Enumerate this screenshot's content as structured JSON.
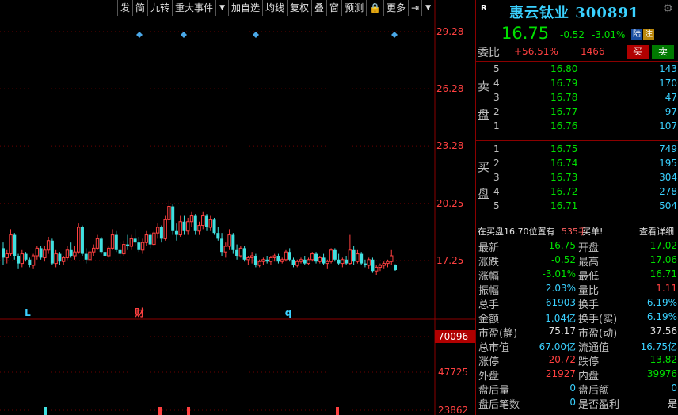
{
  "toolbar": {
    "items": [
      "发",
      "简",
      "九转",
      "重大事件",
      "▼",
      "加自选",
      "均线",
      "复权",
      "叠",
      "窗",
      "预测",
      "🔒",
      "更多",
      "⇥",
      "▼"
    ]
  },
  "chart_data": {
    "type": "candlestick",
    "y_ticks": [
      "29.28",
      "26.28",
      "23.28",
      "20.25",
      "17.25"
    ],
    "volume_ticks": [
      "70096",
      "47725",
      "23862"
    ],
    "markers": [
      "L",
      "财",
      "q"
    ],
    "candles": [
      [
        17.9,
        18.2,
        17.0,
        17.4
      ],
      [
        17.4,
        17.8,
        17.1,
        17.6
      ],
      [
        17.6,
        18.9,
        17.5,
        18.6
      ],
      [
        18.6,
        18.7,
        17.3,
        17.5
      ],
      [
        17.5,
        17.6,
        16.8,
        17.1
      ],
      [
        17.1,
        17.8,
        16.9,
        17.6
      ],
      [
        17.6,
        17.7,
        17.2,
        17.3
      ],
      [
        17.3,
        17.4,
        16.9,
        17.0
      ],
      [
        17.0,
        17.6,
        16.8,
        17.5
      ],
      [
        17.5,
        18.0,
        17.3,
        17.9
      ],
      [
        17.9,
        18.0,
        17.3,
        17.4
      ],
      [
        17.4,
        18.0,
        17.2,
        17.8
      ],
      [
        17.8,
        18.5,
        17.6,
        18.3
      ],
      [
        18.3,
        18.4,
        17.0,
        17.1
      ],
      [
        17.1,
        17.8,
        16.9,
        17.6
      ],
      [
        17.6,
        17.7,
        17.0,
        17.2
      ],
      [
        17.2,
        17.5,
        17.0,
        17.4
      ],
      [
        17.4,
        18.0,
        17.3,
        17.8
      ],
      [
        17.8,
        18.2,
        17.4,
        17.5
      ],
      [
        17.5,
        18.0,
        17.3,
        17.7
      ],
      [
        17.7,
        19.2,
        17.6,
        19.0
      ],
      [
        19.0,
        19.1,
        17.5,
        17.6
      ],
      [
        17.6,
        17.9,
        17.1,
        17.3
      ],
      [
        17.3,
        17.8,
        17.2,
        17.7
      ],
      [
        17.7,
        18.1,
        17.5,
        17.9
      ],
      [
        17.9,
        18.6,
        17.8,
        18.4
      ],
      [
        18.4,
        18.5,
        17.6,
        17.7
      ],
      [
        17.7,
        18.0,
        17.3,
        17.5
      ],
      [
        17.5,
        18.0,
        17.4,
        17.9
      ],
      [
        17.9,
        18.9,
        17.8,
        18.6
      ],
      [
        18.6,
        18.8,
        17.7,
        17.8
      ],
      [
        17.8,
        18.2,
        17.4,
        17.6
      ],
      [
        17.6,
        18.3,
        17.5,
        18.1
      ],
      [
        18.1,
        18.6,
        17.8,
        18.0
      ],
      [
        18.0,
        18.6,
        17.8,
        18.4
      ],
      [
        18.4,
        18.9,
        18.0,
        18.2
      ],
      [
        18.2,
        18.5,
        17.7,
        17.8
      ],
      [
        17.8,
        18.4,
        17.6,
        18.2
      ],
      [
        18.2,
        18.8,
        18.0,
        18.6
      ],
      [
        18.6,
        18.7,
        17.9,
        18.1
      ],
      [
        18.1,
        18.8,
        18.0,
        18.7
      ],
      [
        18.7,
        19.2,
        18.4,
        19.0
      ],
      [
        19.0,
        19.1,
        18.2,
        18.4
      ],
      [
        18.4,
        19.6,
        18.3,
        19.4
      ],
      [
        19.4,
        20.4,
        19.2,
        20.1
      ],
      [
        20.1,
        20.2,
        18.6,
        18.8
      ],
      [
        18.8,
        19.2,
        18.3,
        18.6
      ],
      [
        18.6,
        19.6,
        18.5,
        19.3
      ],
      [
        19.3,
        19.6,
        18.6,
        18.8
      ],
      [
        18.8,
        19.5,
        18.6,
        19.3
      ],
      [
        19.3,
        19.8,
        19.0,
        19.6
      ],
      [
        19.6,
        19.7,
        18.6,
        18.8
      ],
      [
        18.8,
        19.3,
        18.6,
        19.1
      ],
      [
        19.1,
        19.8,
        18.9,
        19.6
      ],
      [
        19.6,
        19.7,
        18.8,
        19.0
      ],
      [
        19.0,
        19.6,
        18.8,
        19.4
      ],
      [
        19.4,
        19.5,
        18.6,
        18.7
      ],
      [
        18.7,
        19.0,
        18.3,
        18.4
      ],
      [
        18.4,
        18.7,
        17.5,
        17.7
      ],
      [
        17.7,
        18.2,
        17.4,
        18.0
      ],
      [
        18.0,
        18.9,
        17.8,
        18.6
      ],
      [
        18.6,
        18.7,
        17.6,
        17.8
      ],
      [
        17.8,
        18.1,
        17.3,
        17.5
      ],
      [
        17.5,
        18.0,
        17.4,
        17.9
      ],
      [
        17.9,
        18.0,
        17.2,
        17.3
      ],
      [
        17.3,
        17.5,
        17.0,
        17.4
      ],
      [
        17.4,
        17.7,
        17.1,
        17.5
      ],
      [
        17.5,
        17.6,
        16.9,
        17.0
      ],
      [
        17.0,
        17.3,
        16.9,
        17.2
      ],
      [
        17.2,
        17.4,
        17.0,
        17.3
      ],
      [
        17.3,
        17.5,
        17.1,
        17.2
      ],
      [
        17.2,
        17.5,
        17.0,
        17.4
      ],
      [
        17.4,
        17.6,
        17.2,
        17.5
      ],
      [
        17.5,
        17.6,
        17.1,
        17.2
      ],
      [
        17.2,
        17.4,
        17.1,
        17.3
      ],
      [
        17.3,
        17.8,
        17.2,
        17.7
      ],
      [
        17.7,
        17.9,
        17.2,
        17.3
      ],
      [
        17.3,
        17.4,
        16.9,
        17.0
      ],
      [
        17.0,
        17.3,
        16.9,
        17.2
      ],
      [
        17.2,
        17.4,
        17.1,
        17.3
      ],
      [
        17.3,
        17.5,
        17.0,
        17.1
      ],
      [
        17.1,
        17.4,
        17.0,
        17.3
      ],
      [
        17.3,
        17.7,
        17.2,
        17.6
      ],
      [
        17.6,
        17.7,
        17.1,
        17.2
      ],
      [
        17.2,
        17.5,
        17.1,
        17.4
      ],
      [
        17.4,
        17.6,
        17.0,
        17.1
      ],
      [
        17.1,
        17.3,
        16.8,
        17.2
      ],
      [
        17.2,
        17.9,
        17.1,
        17.8
      ],
      [
        17.8,
        17.9,
        17.2,
        17.3
      ],
      [
        17.3,
        17.6,
        17.0,
        17.1
      ],
      [
        17.1,
        17.4,
        16.9,
        17.3
      ],
      [
        17.3,
        17.5,
        17.0,
        17.1
      ],
      [
        17.1,
        18.6,
        17.0,
        17.8
      ],
      [
        17.8,
        18.0,
        17.0,
        17.2
      ],
      [
        17.2,
        17.8,
        17.1,
        17.6
      ],
      [
        17.6,
        17.7,
        17.0,
        17.1
      ],
      [
        17.1,
        17.3,
        16.9,
        17.0
      ],
      [
        17.0,
        17.4,
        16.8,
        17.3
      ],
      [
        17.3,
        17.4,
        16.6,
        16.7
      ],
      [
        16.7,
        17.0,
        16.5,
        16.9
      ],
      [
        16.9,
        17.1,
        16.7,
        17.0
      ],
      [
        17.0,
        17.2,
        16.8,
        17.1
      ],
      [
        17.1,
        17.3,
        16.9,
        17.2
      ],
      [
        17.2,
        17.8,
        17.0,
        17.5
      ],
      [
        17.02,
        17.06,
        16.71,
        16.75
      ]
    ]
  },
  "header": {
    "r_badge": "R",
    "title": "惠云钛业 300891",
    "price": "16.75",
    "change": "-0.52",
    "change_pct": "-3.01%",
    "tag_lu": "陆",
    "tag_zhu": "注"
  },
  "weibi": {
    "label": "委比",
    "value": "+56.51%",
    "diff": "1466",
    "buy_label": "买",
    "sell_label": "卖"
  },
  "orderbook": {
    "sell_label_1": "卖",
    "sell_label_2": "盘",
    "buy_label_1": "买",
    "buy_label_2": "盘",
    "sell": [
      {
        "level": "5",
        "price": "16.80",
        "vol": "143"
      },
      {
        "level": "4",
        "price": "16.79",
        "vol": "170"
      },
      {
        "level": "3",
        "price": "16.78",
        "vol": "47"
      },
      {
        "level": "2",
        "price": "16.77",
        "vol": "97"
      },
      {
        "level": "1",
        "price": "16.76",
        "vol": "107"
      }
    ],
    "buy": [
      {
        "level": "1",
        "price": "16.75",
        "vol": "749"
      },
      {
        "level": "2",
        "price": "16.74",
        "vol": "195"
      },
      {
        "level": "3",
        "price": "16.73",
        "vol": "304"
      },
      {
        "level": "4",
        "price": "16.72",
        "vol": "278"
      },
      {
        "level": "5",
        "price": "16.71",
        "vol": "504"
      }
    ]
  },
  "info_bar": {
    "text1": "在买盘16.70位置有",
    "text2": "535手",
    "text3": "买单!",
    "text4": "查看详细"
  },
  "stats": [
    {
      "l1": "最新",
      "v1": "16.75",
      "c1": "c-green",
      "l2": "开盘",
      "v2": "17.02",
      "c2": "c-green"
    },
    {
      "l1": "涨跌",
      "v1": "-0.52",
      "c1": "c-green",
      "l2": "最高",
      "v2": "17.06",
      "c2": "c-green"
    },
    {
      "l1": "涨幅",
      "v1": "-3.01%",
      "c1": "c-green",
      "l2": "最低",
      "v2": "16.71",
      "c2": "c-green"
    },
    {
      "l1": "振幅",
      "v1": "2.03%",
      "c1": "c-cyan",
      "l2": "量比",
      "v2": "1.11",
      "c2": "c-red"
    },
    {
      "l1": "总手",
      "v1": "61903",
      "c1": "c-cyan",
      "l2": "换手",
      "v2": "6.19%",
      "c2": "c-cyan"
    },
    {
      "l1": "金额",
      "v1": "1.04亿",
      "c1": "c-cyan",
      "l2": "换手(实)",
      "v2": "6.19%",
      "c2": "c-cyan"
    },
    {
      "l1": "市盈(静)",
      "v1": "75.17",
      "c1": "c-white",
      "l2": "市盈(动)",
      "v2": "37.56",
      "c2": "c-white"
    },
    {
      "l1": "总市值",
      "v1": "67.00亿",
      "c1": "c-cyan",
      "l2": "流通值",
      "v2": "16.75亿",
      "c2": "c-cyan"
    },
    {
      "l1": "涨停",
      "v1": "20.72",
      "c1": "c-red",
      "l2": "跌停",
      "v2": "13.82",
      "c2": "c-green"
    },
    {
      "l1": "外盘",
      "v1": "21927",
      "c1": "c-red",
      "l2": "内盘",
      "v2": "39976",
      "c2": "c-green"
    },
    {
      "l1": "盘后量",
      "v1": "0",
      "c1": "c-cyan",
      "l2": "盘后额",
      "v2": "0",
      "c2": "c-cyan"
    },
    {
      "l1": "盘后笔数",
      "v1": "0",
      "c1": "c-cyan",
      "l2": "是否盈利",
      "v2": "是",
      "c2": "c-white"
    }
  ]
}
